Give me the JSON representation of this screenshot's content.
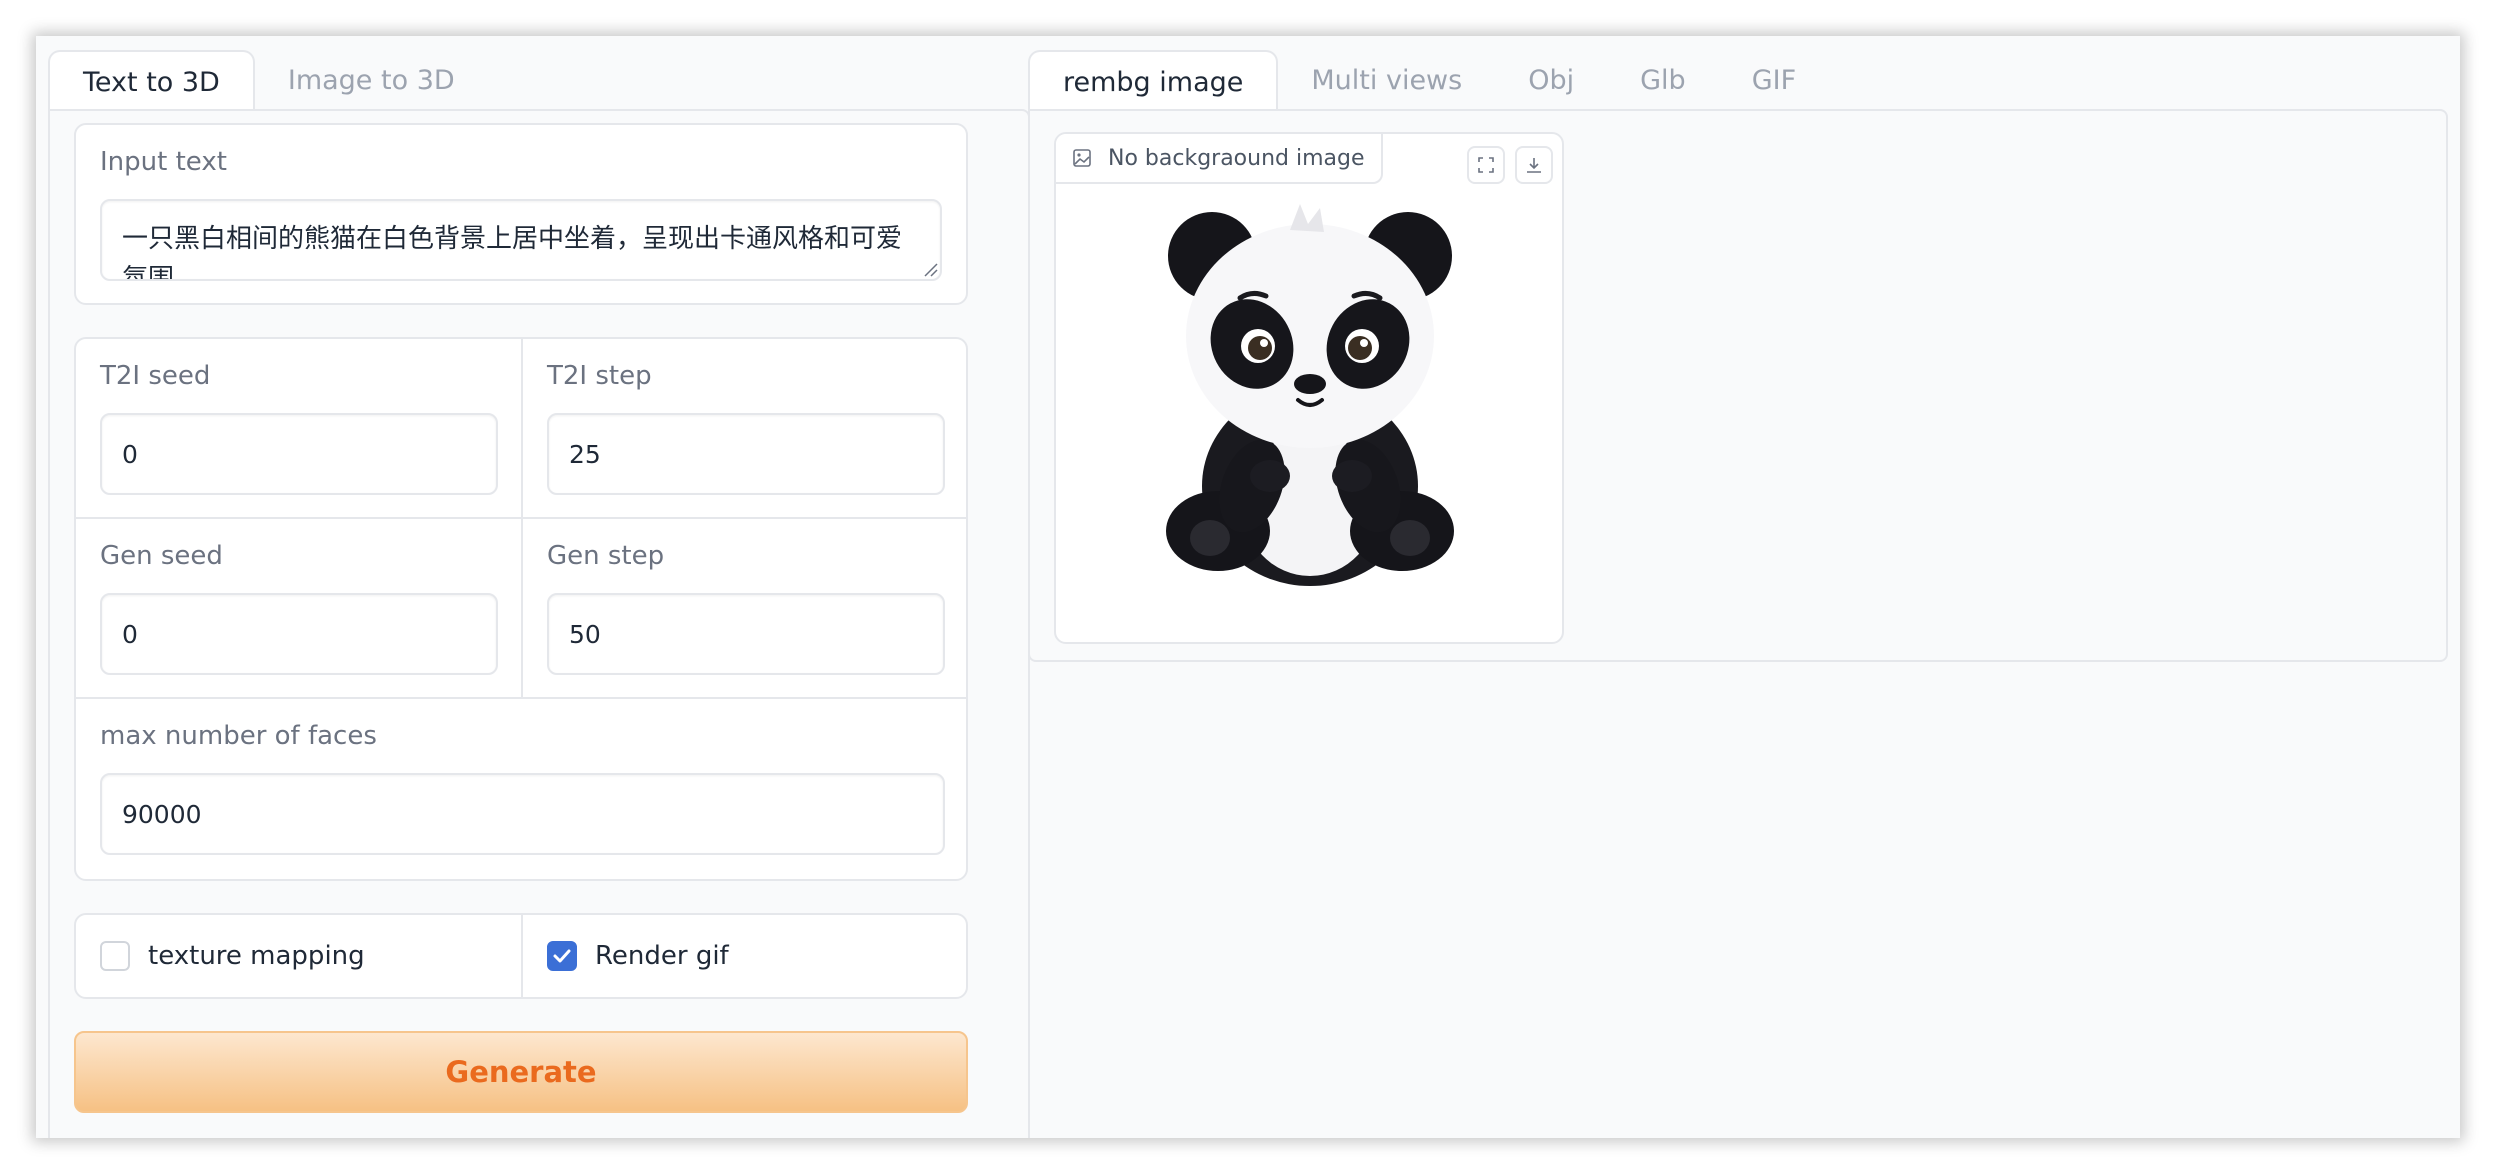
{
  "left_tabs": [
    {
      "label": "Text to 3D",
      "active": true
    },
    {
      "label": "Image to 3D",
      "active": false
    }
  ],
  "input_text": {
    "label": "Input text",
    "value": "一只黑白相间的熊猫在白色背景上居中坐着，呈现出卡通风格和可爱氛围"
  },
  "params": {
    "t2i_seed": {
      "label": "T2I seed",
      "value": "0"
    },
    "t2i_step": {
      "label": "T2I step",
      "value": "25"
    },
    "gen_seed": {
      "label": "Gen seed",
      "value": "0"
    },
    "gen_step": {
      "label": "Gen step",
      "value": "50"
    },
    "max_faces": {
      "label": "max number of faces",
      "value": "90000"
    }
  },
  "options": {
    "texture_mapping": {
      "label": "texture mapping",
      "checked": false
    },
    "render_gif": {
      "label": "Render gif",
      "checked": true
    }
  },
  "generate": {
    "label": "Generate"
  },
  "right_tabs": [
    {
      "label": "rembg image",
      "active": true
    },
    {
      "label": "Multi views",
      "active": false
    },
    {
      "label": "Obj",
      "active": false
    },
    {
      "label": "Glb",
      "active": false
    },
    {
      "label": "GIF",
      "active": false
    }
  ],
  "output_image": {
    "label": "No backgraound image"
  },
  "colors": {
    "accent_orange": "#ea6a1e",
    "checkbox_blue": "#3b6fd6",
    "border": "#e5e7eb"
  }
}
